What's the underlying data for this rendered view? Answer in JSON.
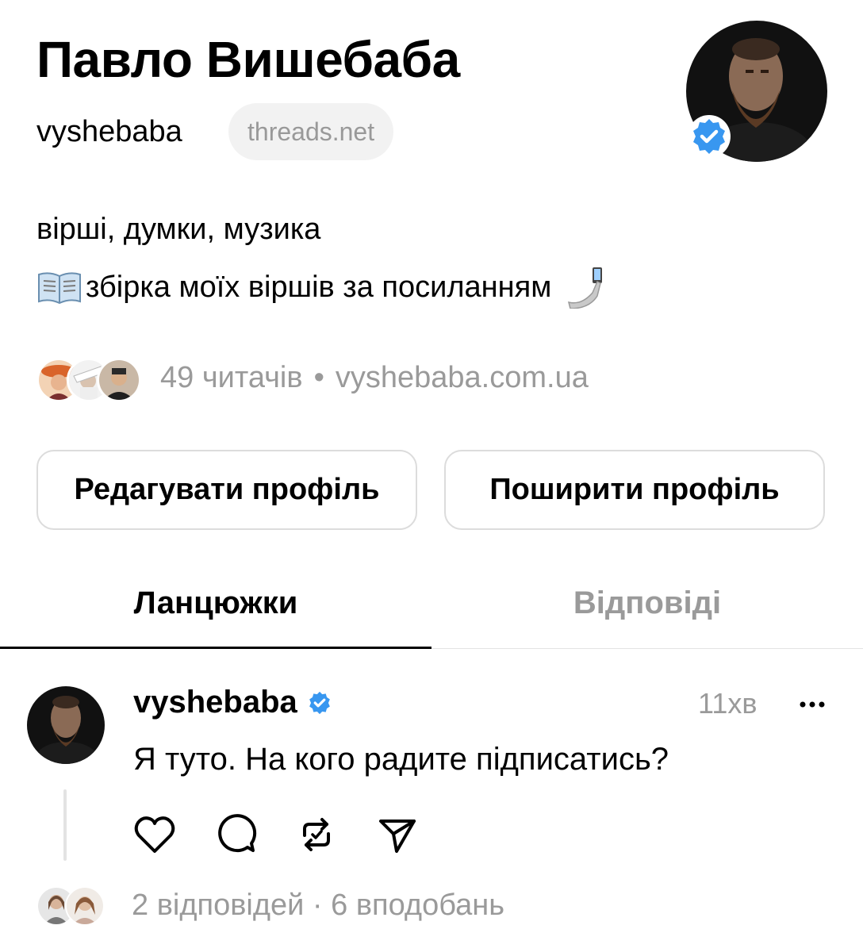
{
  "profile": {
    "name": "Павло Вишебаба",
    "username": "vyshebaba",
    "domain_badge": "threads.net",
    "bio_line1": "вірші, думки, музика",
    "bio_line2": "збірка моїх віршів за посиланням",
    "bio_line2_icons": [
      "open-book-emoji",
      "selfie-hand-emoji"
    ],
    "followers_text": "49 читачів",
    "separator": "•",
    "link": "vyshebaba.com.ua",
    "verified": true
  },
  "buttons": {
    "edit": "Редагувати профіль",
    "share": "Поширити профіль"
  },
  "tabs": [
    {
      "label": "Ланцюжки",
      "active": true
    },
    {
      "label": "Відповіді",
      "active": false
    }
  ],
  "post": {
    "username": "vyshebaba",
    "time": "11хв",
    "text": "Я туто. На кого радите підписатись?",
    "actions": [
      "heart-icon",
      "comment-icon",
      "repost-icon",
      "share-icon"
    ],
    "replies_summary": "2 відповідей · 6 вподобань"
  },
  "colors": {
    "verified_blue": "#3897f0",
    "muted_text": "#9a9a9a",
    "border": "#dcdcdc"
  }
}
